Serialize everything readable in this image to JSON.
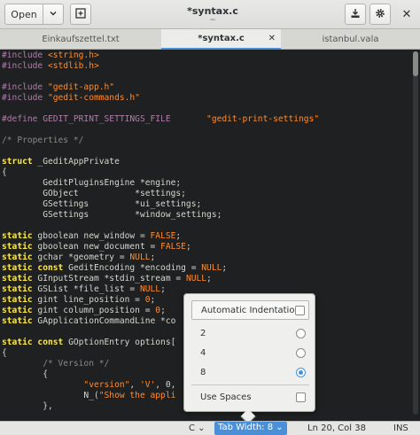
{
  "header": {
    "open_label": "Open",
    "title": "*syntax.c",
    "subtitle": "~",
    "icons": [
      "chevron-down-icon",
      "new-tab-icon",
      "save-icon",
      "gear-icon",
      "close-icon"
    ]
  },
  "tabs": [
    {
      "label": "Einkaufszettel.txt",
      "active": false
    },
    {
      "label": "*syntax.c",
      "active": true
    },
    {
      "label": "istanbul.vala",
      "active": false
    }
  ],
  "editor": {
    "lines": [
      [
        {
          "t": "#include ",
          "c": "pp"
        },
        {
          "t": "<string.h>",
          "c": "str"
        }
      ],
      [
        {
          "t": "#include ",
          "c": "pp"
        },
        {
          "t": "<stdlib.h>",
          "c": "str"
        }
      ],
      [],
      [
        {
          "t": "#include ",
          "c": "pp"
        },
        {
          "t": "\"gedit-app.h\"",
          "c": "str"
        }
      ],
      [
        {
          "t": "#include ",
          "c": "pp"
        },
        {
          "t": "\"gedit-commands.h\"",
          "c": "str"
        }
      ],
      [],
      [
        {
          "t": "#define GEDIT_PRINT_SETTINGS_FILE       ",
          "c": "pp"
        },
        {
          "t": "\"gedit-print-settings\"",
          "c": "str"
        }
      ],
      [],
      [
        {
          "t": "/* Properties */",
          "c": "cm"
        }
      ],
      [],
      [
        {
          "t": "struct",
          "c": "kw"
        },
        {
          "t": " _GeditAppPrivate",
          "c": ""
        }
      ],
      [
        {
          "t": "{",
          "c": ""
        }
      ],
      [
        {
          "t": "        GeditPluginsEngine *engine;",
          "c": ""
        }
      ],
      [
        {
          "t": "        GObject           *settings;",
          "c": ""
        }
      ],
      [
        {
          "t": "        GSettings         *ui_settings;",
          "c": ""
        }
      ],
      [
        {
          "t": "        GSettings         *window_settings;",
          "c": ""
        }
      ],
      [],
      [
        {
          "t": "static",
          "c": "kw"
        },
        {
          "t": " gboolean new_window = ",
          "c": ""
        },
        {
          "t": "FALSE",
          "c": "nb"
        },
        {
          "t": ";",
          "c": ""
        }
      ],
      [
        {
          "t": "static",
          "c": "kw"
        },
        {
          "t": " gboolean new_document = ",
          "c": ""
        },
        {
          "t": "FALSE",
          "c": "nb"
        },
        {
          "t": ";",
          "c": ""
        }
      ],
      [
        {
          "t": "static",
          "c": "kw"
        },
        {
          "t": " gchar *geometry = ",
          "c": ""
        },
        {
          "t": "NULL",
          "c": "nb"
        },
        {
          "t": ";",
          "c": ""
        }
      ],
      [
        {
          "t": "static const",
          "c": "kw"
        },
        {
          "t": " GeditEncoding *encoding = ",
          "c": ""
        },
        {
          "t": "NULL",
          "c": "nb"
        },
        {
          "t": ";",
          "c": ""
        }
      ],
      [
        {
          "t": "static",
          "c": "kw"
        },
        {
          "t": " GInputStream *stdin_stream = ",
          "c": ""
        },
        {
          "t": "NULL",
          "c": "nb"
        },
        {
          "t": ";",
          "c": ""
        }
      ],
      [
        {
          "t": "static",
          "c": "kw"
        },
        {
          "t": " GSList *file_list = ",
          "c": ""
        },
        {
          "t": "NULL",
          "c": "nb"
        },
        {
          "t": ";",
          "c": ""
        }
      ],
      [
        {
          "t": "static",
          "c": "kw"
        },
        {
          "t": " gint line_position = ",
          "c": ""
        },
        {
          "t": "0",
          "c": "nb"
        },
        {
          "t": ";",
          "c": ""
        }
      ],
      [
        {
          "t": "static",
          "c": "kw"
        },
        {
          "t": " gint column_position = ",
          "c": ""
        },
        {
          "t": "0",
          "c": "nb"
        },
        {
          "t": ";",
          "c": ""
        }
      ],
      [
        {
          "t": "static",
          "c": "kw"
        },
        {
          "t": " GApplicationCommandLine *co",
          "c": ""
        }
      ],
      [],
      [
        {
          "t": "static const",
          "c": "kw"
        },
        {
          "t": " GOptionEntry options[",
          "c": ""
        }
      ],
      [
        {
          "t": "{",
          "c": ""
        }
      ],
      [
        {
          "t": "        /* Version */",
          "c": "cm"
        }
      ],
      [
        {
          "t": "        {",
          "c": ""
        }
      ],
      [
        {
          "t": "                ",
          "c": ""
        },
        {
          "t": "\"version\"",
          "c": "str"
        },
        {
          "t": ", ",
          "c": ""
        },
        {
          "t": "'V'",
          "c": "str"
        },
        {
          "t": ", 0,",
          "c": ""
        }
      ],
      [
        {
          "t": "                N_(",
          "c": ""
        },
        {
          "t": "\"Show the appli",
          "c": "str"
        }
      ],
      [
        {
          "t": "        },",
          "c": ""
        }
      ]
    ]
  },
  "statusbar": {
    "language": "C",
    "tab_width": "Tab Width: 8",
    "position": "Ln 20, Col 38",
    "mode": "INS"
  },
  "popover": {
    "automatic_indentation_label": "Automatic Indentation",
    "automatic_indentation_checked": false,
    "tab_options": [
      "2",
      "4",
      "8"
    ],
    "selected_tab": "8",
    "use_spaces_label": "Use Spaces",
    "use_spaces_checked": false
  }
}
